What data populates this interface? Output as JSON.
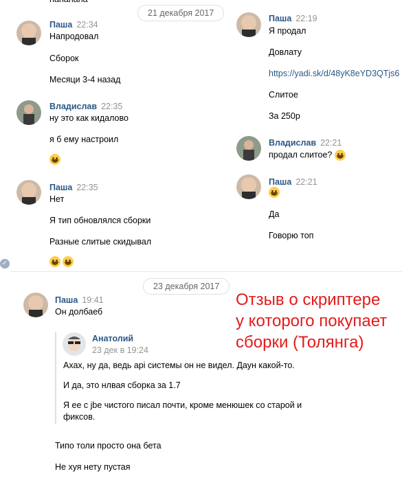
{
  "top_fragment": "hahahaha",
  "dates": {
    "d1": "21 декабря 2017",
    "d2": "23 декабря 2017"
  },
  "left": {
    "m1": {
      "name": "Паша",
      "time": "22:34",
      "lines": [
        "Напродовал",
        "Сборок",
        "Месяци 3-4 назад"
      ]
    },
    "m2": {
      "name": "Владислав",
      "time": "22:35",
      "lines": [
        "ну это как кидалово",
        "я б ему настроил"
      ]
    },
    "m3": {
      "name": "Паша",
      "time": "22:35",
      "lines": [
        "Нет",
        "Я тип обновлялся сборки",
        "Разные слитые скидывал"
      ]
    }
  },
  "right": {
    "m1": {
      "name": "Паша",
      "time": "22:19",
      "lines": [
        "Я продал",
        "Довлату",
        "https://yadi.sk/d/48yK8eYD3QTjs6",
        "Слитое",
        "За 250р"
      ]
    },
    "m2": {
      "name": "Владислав",
      "time": "22:21",
      "lines": [
        "продал слитое?"
      ]
    },
    "m3": {
      "name": "Паша",
      "time": "22:21",
      "lines": [
        "Да",
        "Говорю топ"
      ]
    }
  },
  "bottom": {
    "m1": {
      "name": "Паша",
      "time": "19:41",
      "lines": [
        "Он долбаеб"
      ]
    },
    "forward": {
      "name": "Анатолий",
      "date": "23 дек в 19:24",
      "lines": [
        "Ахах, ну да, ведь api системы он не видел. Даун какой-то.",
        "И да, это нлвая сборка за 1.7",
        "Я ее с jbe чистого писал почти, кроме менюшек со старой и",
        "фиксов."
      ]
    },
    "after_lines": [
      "Типо толи просто она бета",
      "Не хуя нету пустая"
    ]
  },
  "annotation": [
    "Отзыв о скриптере",
    "у которого покупает",
    "сборки (Толянга)"
  ],
  "colors": {
    "link": "#2a5885",
    "annotation": "#e31b1b",
    "time": "#939393"
  }
}
